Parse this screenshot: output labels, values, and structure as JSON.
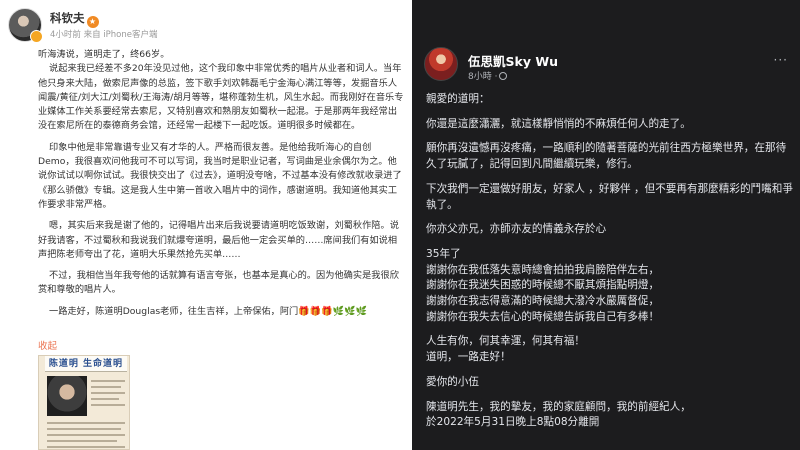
{
  "left_post": {
    "author": "科钦夫",
    "meta": "4小时前  来自 iPhone客户端",
    "paragraphs": [
      "听海涛说，道明走了，终66岁。",
      "说起来我已经差不多20年没见过他，这个我印象中非常优秀的唱片从业者和词人。当年他只身来大陆，做索尼声像的总监，签下歌手刘欢韩磊毛宁金海心满江等等，发掘音乐人闻震/黄征/刘大江/刘蜀秋/王海涛/胡月等等，堪称蓬勃生机，风生水起。而我刚好在音乐专业媒体工作关系要经常去索尼，又特别喜欢和熟朋友如蜀秋一起混。于是那两年我经常出没在索尼所在的泰德商务会馆，还经常一起楼下一起吃饭。道明很多时候都在。",
      "印象中他是非常靠谱专业又有才华的人。严格而很友善。是他给我听海心的自创Demo，我很喜欢问他我可不可以写词，我当时是职业记者，写词曲是业余偶尔为之。他说你试试以啊你试试。我很快交出了《过去》，道明没夸啥，不过基本没有修改就收录进了《那么骄傲》专辑。这是我人生中第一首收入唱片中的词作，感谢道明。我知道他其实工作要求非常严格。",
      "嗯，其实后来我是谢了他的，记得唱片出来后我说要请道明吃饭致谢，刘蜀秋作陪。说好我请客，不过蜀秋和我说我们就爆夸道明，最后他一定会买单的……席间我们有如说相声把陈老师夸出了花，道明大乐果然抢先买单……",
      "不过，我相信当年我夸他的话就算有语言夸张，也基本是真心的。因为他确实是我很欣赏和尊敬的唱片人。",
      "一路走好，陈道明Douglas老师，往生吉祥，上帝保佑，阿门🎁🎁🎁🌿🌿🌿"
    ],
    "collapse_label": "收起",
    "clipping_headline": "陈道明 生命道明"
  },
  "right_post": {
    "author": "伍思凱Sky Wu",
    "meta": "8小時 ·",
    "more_label": "···",
    "lines": [
      "親愛的道明：",
      "",
      "你還是這麼瀟灑，就這樣靜悄悄的不麻煩任何人的走了。",
      "",
      "願你再沒遺憾再沒疼痛，一路順利的隨著菩薩的光前往西方極樂世界，在那待久了玩膩了，記得回到凡間繼續玩樂，修行。",
      "",
      "下次我們一定還做好朋友，好家人  ，好夥伴    ，但不要再有那麼精彩的鬥嘴和爭執了。",
      "",
      "你亦父亦兄，亦師亦友的情義永存於心",
      "",
      "35年了",
      "謝謝你在我低落失意時總會拍拍我肩膀陪伴左右，",
      "謝謝你在我迷失困惑的時候總不厭其煩指點明燈，",
      "謝謝你在我志得意滿的時候總大潑冷水嚴厲督促，",
      "謝謝你在我失去信心的時候總告訴我自己有多棒！",
      "",
      "人生有你，何其幸運，何其有福！",
      "道明，一路走好！",
      "",
      "愛你的小伍",
      "",
      "陳道明先生，我的摯友，我的家庭顧問，我的前經紀人，",
      "於2022年5月31日晚上8點08分離開"
    ]
  },
  "colors": {
    "left_bg": "#ffffff",
    "right_bg": "#1c1c1e",
    "link_orange": "#eb7350",
    "right_text": "#e4e6eb"
  }
}
